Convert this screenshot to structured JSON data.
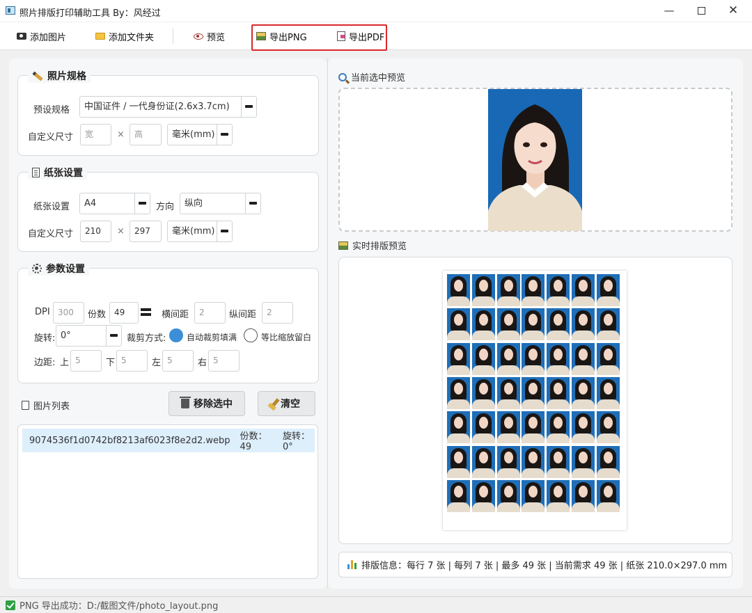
{
  "window": {
    "title": "照片排版打印辅助工具 By：风经过",
    "minimize": "—",
    "close": "✕"
  },
  "toolbar": {
    "add_image": "添加图片",
    "add_folder": "添加文件夹",
    "preview": "预览",
    "export_png": "导出PNG",
    "export_pdf": "导出PDF"
  },
  "photo_spec": {
    "title": "照片规格",
    "preset_label": "预设规格",
    "preset_value": "中国证件 / 一代身份证(2.6x3.7cm)",
    "custom_size_label": "自定义尺寸",
    "width_placeholder": "宽",
    "times": "×",
    "height_placeholder": "高",
    "unit": "毫米(mm)"
  },
  "paper": {
    "title": "纸张设置",
    "paper_label": "纸张设置",
    "paper_value": "A4",
    "orientation_label": "方向",
    "orientation_value": "纵向",
    "custom_size_label": "自定义尺寸",
    "width": "210",
    "times": "×",
    "height": "297",
    "unit": "毫米(mm)"
  },
  "params": {
    "title": "参数设置",
    "dpi_label": "DPI",
    "dpi_value": "300",
    "copies_label": "份数",
    "copies_value": "49",
    "h_gap_label": "横间距",
    "h_gap_value": "2",
    "v_gap_label": "纵间距",
    "v_gap_value": "2",
    "rotate_label": "旋转:",
    "rotate_value": "0°",
    "crop_label": "裁剪方式:",
    "crop_option_auto": "自动裁剪填满",
    "crop_option_scale": "等比缩放留白",
    "margin_label": "边距:",
    "margin_top_label": "上",
    "margin_top": "5",
    "margin_bottom_label": "下",
    "margin_bottom": "5",
    "margin_left_label": "左",
    "margin_left": "5",
    "margin_right_label": "右",
    "margin_right": "5"
  },
  "image_list": {
    "title": "图片列表",
    "remove_button": "移除选中",
    "clear_button": "清空",
    "items": [
      {
        "filename": "9074536f1d0742bf8213af6023f8e2d2.webp",
        "copies": "份数：49",
        "rotation": "旋转：0°"
      }
    ]
  },
  "preview": {
    "current_title": "当前选中预览",
    "layout_title": "实时排版预览",
    "grid_rows": 7,
    "grid_cols": 7,
    "info": "排版信息：每行 7 张 | 每列 7 张 | 最多 49 张 | 当前需求 49 张 | 纸张 210.0×297.0 mm"
  },
  "status": {
    "text": "PNG 导出成功：D:/截图文件/photo_layout.png"
  },
  "colors": {
    "accent_red": "#d9282b",
    "radio_blue": "#3c8fd6",
    "photo_bg": "#1868b6",
    "list_selected": "#deeffc"
  }
}
